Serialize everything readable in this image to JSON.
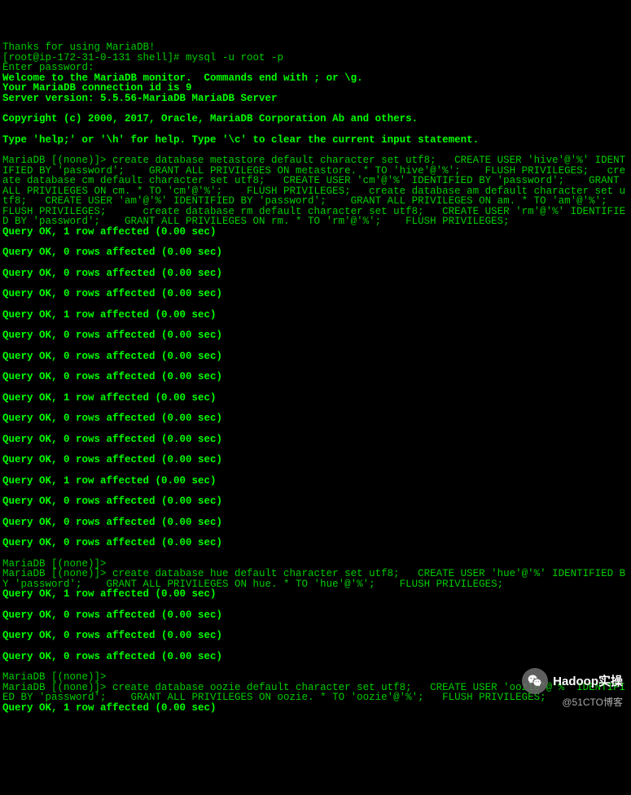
{
  "terminal": {
    "lines": [
      {
        "text": "Thanks for using MariaDB!",
        "bold": false,
        "blank": false
      },
      {
        "text": "[root@ip-172-31-0-131 shell]# mysql -u root -p",
        "bold": false,
        "blank": false
      },
      {
        "text": "Enter password:",
        "bold": false,
        "blank": false
      },
      {
        "text": "Welcome to the MariaDB monitor.  Commands end with ; or \\g.",
        "bold": true,
        "blank": false
      },
      {
        "text": "Your MariaDB connection id is 9",
        "bold": true,
        "blank": false
      },
      {
        "text": "Server version: 5.5.56-MariaDB MariaDB Server",
        "bold": true,
        "blank": false
      },
      {
        "text": "",
        "bold": false,
        "blank": true
      },
      {
        "text": "Copyright (c) 2000, 2017, Oracle, MariaDB Corporation Ab and others.",
        "bold": true,
        "blank": false
      },
      {
        "text": "",
        "bold": false,
        "blank": true
      },
      {
        "text": "Type 'help;' or '\\h' for help. Type '\\c' to clear the current input statement.",
        "bold": true,
        "blank": false
      },
      {
        "text": "",
        "bold": false,
        "blank": true
      },
      {
        "text": "MariaDB [(none)]> create database metastore default character set utf8;   CREATE USER 'hive'@'%' IDENTIFIED BY 'password';    GRANT ALL PRIVILEGES ON metastore. * TO 'hive'@'%';    FLUSH PRIVILEGES;   create database cm default character set utf8;   CREATE USER 'cm'@'%' IDENTIFIED BY 'password';    GRANT ALL PRIVILEGES ON cm. * TO 'cm'@'%';    FLUSH PRIVILEGES;   create database am default character set utf8;   CREATE USER 'am'@'%' IDENTIFIED BY 'password';    GRANT ALL PRIVILEGES ON am. * TO 'am'@'%';    FLUSH PRIVILEGES;      create database rm default character set utf8;   CREATE USER 'rm'@'%' IDENTIFIED BY 'password';    GRANT ALL PRIVILEGES ON rm. * TO 'rm'@'%';    FLUSH PRIVILEGES;",
        "bold": false,
        "blank": false
      },
      {
        "text": "Query OK, 1 row affected (0.00 sec)",
        "bold": true,
        "blank": false
      },
      {
        "text": "",
        "bold": false,
        "blank": true
      },
      {
        "text": "Query OK, 0 rows affected (0.00 sec)",
        "bold": true,
        "blank": false
      },
      {
        "text": "",
        "bold": false,
        "blank": true
      },
      {
        "text": "Query OK, 0 rows affected (0.00 sec)",
        "bold": true,
        "blank": false
      },
      {
        "text": "",
        "bold": false,
        "blank": true
      },
      {
        "text": "Query OK, 0 rows affected (0.00 sec)",
        "bold": true,
        "blank": false
      },
      {
        "text": "",
        "bold": false,
        "blank": true
      },
      {
        "text": "Query OK, 1 row affected (0.00 sec)",
        "bold": true,
        "blank": false
      },
      {
        "text": "",
        "bold": false,
        "blank": true
      },
      {
        "text": "Query OK, 0 rows affected (0.00 sec)",
        "bold": true,
        "blank": false
      },
      {
        "text": "",
        "bold": false,
        "blank": true
      },
      {
        "text": "Query OK, 0 rows affected (0.00 sec)",
        "bold": true,
        "blank": false
      },
      {
        "text": "",
        "bold": false,
        "blank": true
      },
      {
        "text": "Query OK, 0 rows affected (0.00 sec)",
        "bold": true,
        "blank": false
      },
      {
        "text": "",
        "bold": false,
        "blank": true
      },
      {
        "text": "Query OK, 1 row affected (0.00 sec)",
        "bold": true,
        "blank": false
      },
      {
        "text": "",
        "bold": false,
        "blank": true
      },
      {
        "text": "Query OK, 0 rows affected (0.00 sec)",
        "bold": true,
        "blank": false
      },
      {
        "text": "",
        "bold": false,
        "blank": true
      },
      {
        "text": "Query OK, 0 rows affected (0.00 sec)",
        "bold": true,
        "blank": false
      },
      {
        "text": "",
        "bold": false,
        "blank": true
      },
      {
        "text": "Query OK, 0 rows affected (0.00 sec)",
        "bold": true,
        "blank": false
      },
      {
        "text": "",
        "bold": false,
        "blank": true
      },
      {
        "text": "Query OK, 1 row affected (0.00 sec)",
        "bold": true,
        "blank": false
      },
      {
        "text": "",
        "bold": false,
        "blank": true
      },
      {
        "text": "Query OK, 0 rows affected (0.00 sec)",
        "bold": true,
        "blank": false
      },
      {
        "text": "",
        "bold": false,
        "blank": true
      },
      {
        "text": "Query OK, 0 rows affected (0.00 sec)",
        "bold": true,
        "blank": false
      },
      {
        "text": "",
        "bold": false,
        "blank": true
      },
      {
        "text": "Query OK, 0 rows affected (0.00 sec)",
        "bold": true,
        "blank": false
      },
      {
        "text": "",
        "bold": false,
        "blank": true
      },
      {
        "text": "MariaDB [(none)]>",
        "bold": false,
        "blank": false
      },
      {
        "text": "MariaDB [(none)]> create database hue default character set utf8;   CREATE USER 'hue'@'%' IDENTIFIED BY 'password';    GRANT ALL PRIVILEGES ON hue. * TO 'hue'@'%';    FLUSH PRIVILEGES;",
        "bold": false,
        "blank": false
      },
      {
        "text": "Query OK, 1 row affected (0.00 sec)",
        "bold": true,
        "blank": false
      },
      {
        "text": "",
        "bold": false,
        "blank": true
      },
      {
        "text": "Query OK, 0 rows affected (0.00 sec)",
        "bold": true,
        "blank": false
      },
      {
        "text": "",
        "bold": false,
        "blank": true
      },
      {
        "text": "Query OK, 0 rows affected (0.00 sec)",
        "bold": true,
        "blank": false
      },
      {
        "text": "",
        "bold": false,
        "blank": true
      },
      {
        "text": "Query OK, 0 rows affected (0.00 sec)",
        "bold": true,
        "blank": false
      },
      {
        "text": "",
        "bold": false,
        "blank": true
      },
      {
        "text": "MariaDB [(none)]>",
        "bold": false,
        "blank": false
      },
      {
        "text": "MariaDB [(none)]> create database oozie default character set utf8;   CREATE USER 'oozie'@'%' IDENTIFIED BY 'password';    GRANT ALL PRIVILEGES ON oozie. * TO 'oozie'@'%';   FLUSH PRIVILEGES;",
        "bold": false,
        "blank": false
      },
      {
        "text": "Query OK, 1 row affected (0.00 sec)",
        "bold": true,
        "blank": false
      },
      {
        "text": "",
        "bold": false,
        "blank": true
      }
    ]
  },
  "watermark": {
    "top_text": "Hadoop实操",
    "bottom_text": "@51CTO博客"
  }
}
